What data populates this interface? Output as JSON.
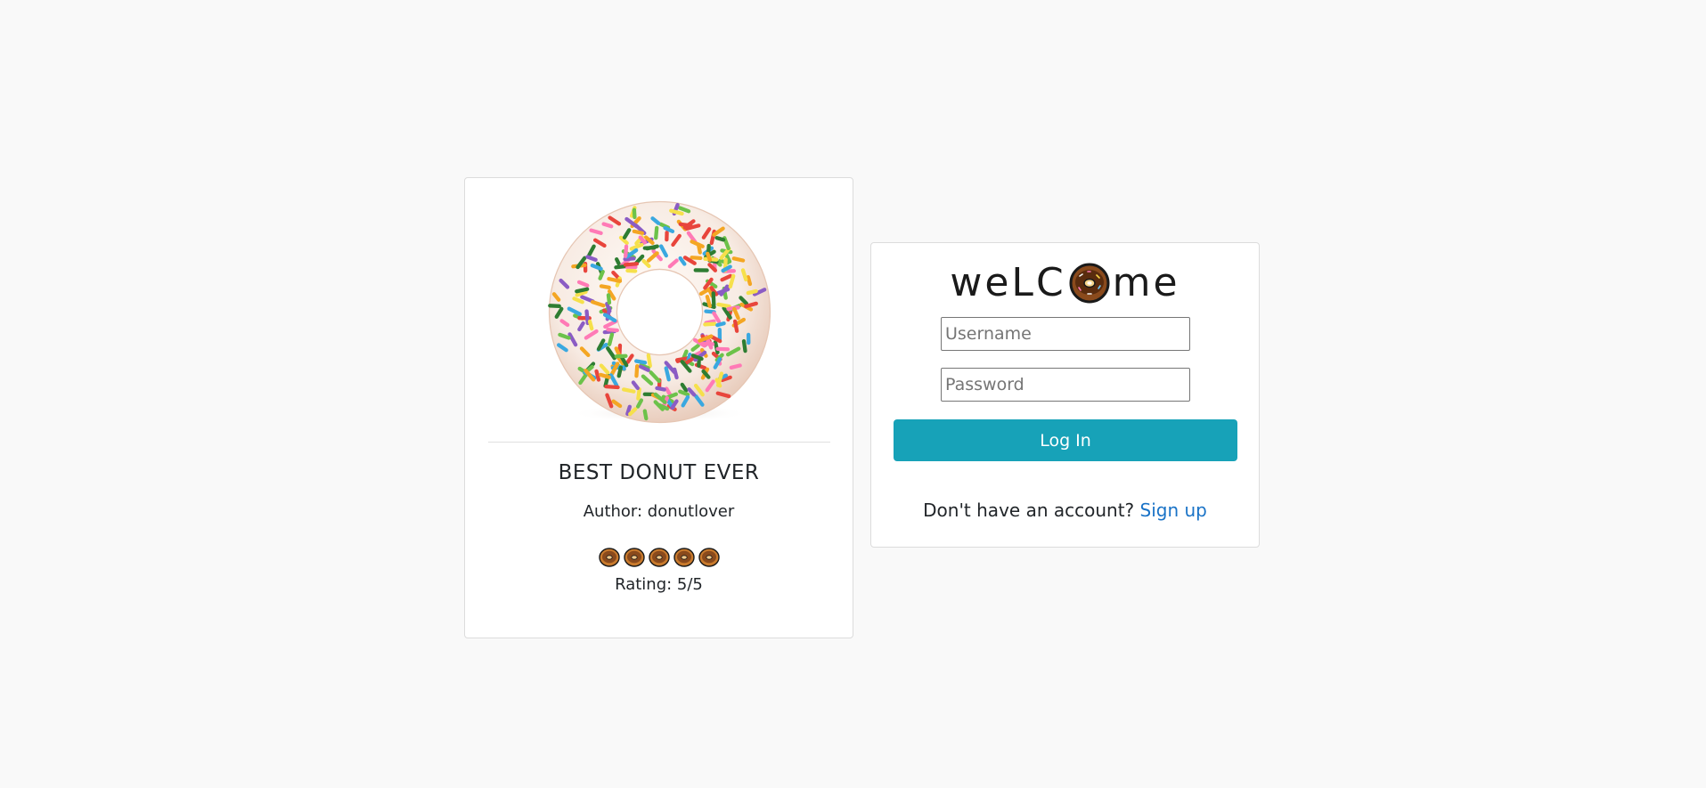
{
  "post": {
    "title": "BEST DONUT EVER",
    "author": "Author: donutlover",
    "rating_text": "Rating: 5/5",
    "rating_value": 5,
    "rating_max": 5,
    "rating_icon": "donut-icon"
  },
  "login": {
    "welcome_left": "weLC",
    "welcome_right": "me",
    "welcome_o_icon": "donut-icon",
    "username_placeholder": "Username",
    "password_placeholder": "Password",
    "login_label": "Log In",
    "signup_prompt": "Don't have an account?",
    "signup_link": "Sign up"
  },
  "colors": {
    "page_background": "#f9f9f9",
    "button": "#17a2b8",
    "link": "#1a73c7"
  }
}
